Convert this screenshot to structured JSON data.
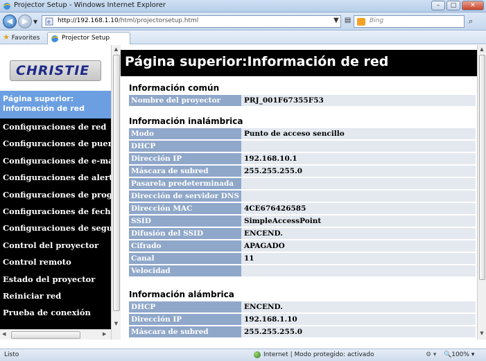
{
  "window": {
    "title": "Projector Setup - Windows Internet Explorer",
    "controls": [
      "–",
      "□",
      "✕"
    ]
  },
  "address_bar": {
    "url_host": "http://192.168.1.10",
    "url_path": "/html/projectorsetup.html",
    "search_placeholder": "Bing"
  },
  "favorites_bar": {
    "favorites_label": "Favorites",
    "tab_title": "Projector Setup"
  },
  "sidebar": {
    "logo_text": "CHRISTIE",
    "selected_line1": "Página superior:",
    "selected_line2": "Información de red",
    "items": [
      "Configuraciones de red",
      "Configuraciones de puer",
      "Configuraciones de e-ma",
      "Configuraciones de alert",
      "Configuraciones de prog",
      "Configuraciones de fech",
      "Configuraciones de segu",
      "Control del proyector",
      "Control remoto",
      "Estado del proyector",
      "Reiniciar red",
      "Prueba de conexión"
    ]
  },
  "main": {
    "page_title": "Página superior:Información de red",
    "sections": [
      {
        "title": "Información común",
        "rows": [
          {
            "label": "Nombre del proyector",
            "value": "PRJ_001F67355F53"
          }
        ]
      },
      {
        "title": "Información inalámbrica",
        "rows": [
          {
            "label": "Modo",
            "value": "Punto de acceso sencillo"
          },
          {
            "label": "DHCP",
            "value": ""
          },
          {
            "label": "Dirección IP",
            "value": "192.168.10.1"
          },
          {
            "label": "Máscara de subred",
            "value": "255.255.255.0"
          },
          {
            "label": "Pasarela predeterminada",
            "value": ""
          },
          {
            "label": "Dirección de servidor DNS",
            "value": ""
          },
          {
            "label": "Dirección MAC",
            "value": "4CE676426585"
          },
          {
            "label": "SSID",
            "value": "SimpleAccessPoint"
          },
          {
            "label": "Difusión del SSID",
            "value": "ENCEND."
          },
          {
            "label": "Cifrado",
            "value": "APAGADO"
          },
          {
            "label": "Canal",
            "value": "11"
          },
          {
            "label": "Velocidad",
            "value": ""
          }
        ]
      },
      {
        "title": "Información alámbrica",
        "rows": [
          {
            "label": "DHCP",
            "value": "ENCEND."
          },
          {
            "label": "Dirección IP",
            "value": "192.168.1.10"
          },
          {
            "label": "Máscara de subred",
            "value": "255.255.255.0"
          }
        ]
      }
    ]
  },
  "status_bar": {
    "status": "Listo",
    "zone": "Internet | Modo protegido: activado",
    "zoom": "100%"
  },
  "colors": {
    "label_cell_bg": "#8fa7c9",
    "value_cell_bg": "#e4e9f0",
    "nav_selected_bg": "#6b9fe2",
    "nav_bg": "#000000",
    "header_bg": "#000000",
    "logo_text": "#1e2a88"
  }
}
